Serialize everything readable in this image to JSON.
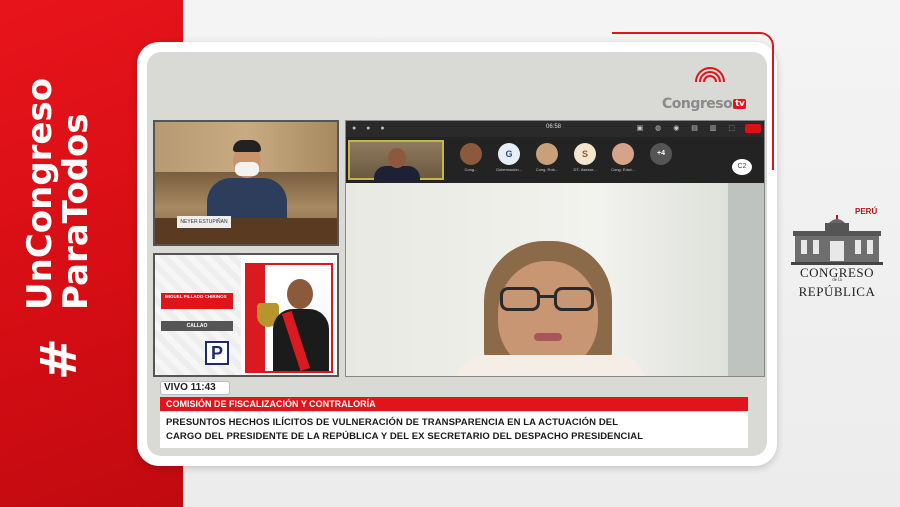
{
  "sidebar": {
    "hashtag_symbol": "#",
    "hashtag_line1": "UnCongreso",
    "hashtag_line2": "ParaTodos"
  },
  "channel": {
    "brand": "Congreso",
    "brand_suffix": "tv"
  },
  "left_videos": {
    "nameplate": "NEYER ESTUPIÑAN",
    "card_name": "MIGUEL PILLADO CHIRINOS",
    "card_region": "CALLAO",
    "party_letter": "P"
  },
  "zoom": {
    "time": "06:58",
    "participants": [
      {
        "initial": "",
        "name": "Cong..."
      },
      {
        "initial": "G",
        "name": "Gobernación..."
      },
      {
        "initial": "",
        "name": "Cong. Rob..."
      },
      {
        "initial": "S",
        "name": "DT- Asesor..."
      },
      {
        "initial": "",
        "name": "Cong. Edwi..."
      },
      {
        "initial": "+4",
        "name": ""
      }
    ],
    "more": "C2"
  },
  "lower_third": {
    "live": "VIVO 11:43",
    "commission": "COMISIÓN DE FISCALIZACIÓN Y CONTRALORÍA",
    "headline_line1": "PRESUNTOS HECHOS ILÍCITOS DE VULNERACIÓN DE TRANSPARENCIA EN LA ACTUACIÓN DEL",
    "headline_line2": "CARGO DEL PRESIDENTE DE LA REPÚBLICA Y DEL EX SECRETARIO DEL DESPACHO PRESIDENCIAL"
  },
  "logo": {
    "country": "PERÚ",
    "line1": "CONGRESO",
    "line2": "de la",
    "line3": "REPÚBLICA"
  },
  "colors": {
    "brand_red": "#e0141b",
    "background": "#f0f0f0"
  }
}
